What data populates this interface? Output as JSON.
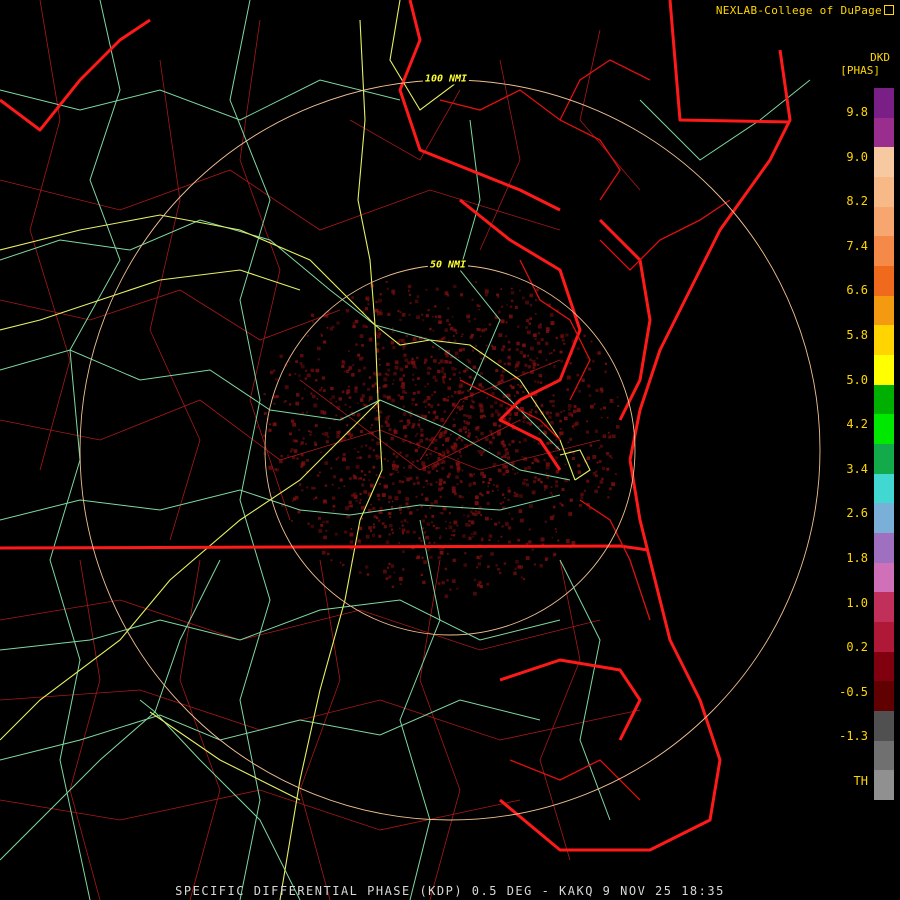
{
  "header": {
    "credit": "NEXLAB-College of DuPage",
    "credit_icon": "external-link-icon"
  },
  "legend": {
    "product_code": "DKD",
    "units": "[PHAS]",
    "scale_labels": [
      "9.8",
      "9.0",
      "8.2",
      "7.4",
      "6.6",
      "5.8",
      "5.0",
      "4.2",
      "3.4",
      "2.6",
      "1.8",
      "1.0",
      "0.2",
      "-0.5",
      "-1.3",
      "TH"
    ],
    "colorbar": [
      "#7a1f86",
      "#9a2e8e",
      "#f6c9a0",
      "#f8b989",
      "#f8a66f",
      "#f58a48",
      "#f06a1e",
      "#f39a10",
      "#ffd400",
      "#ffff00",
      "#00b000",
      "#00e800",
      "#12aa4a",
      "#40d8d0",
      "#7ab0d8",
      "#a070c0",
      "#d070b8",
      "#c0305a",
      "#b01838",
      "#800010",
      "#600000",
      "#505050",
      "#707070",
      "#909090"
    ]
  },
  "map": {
    "range_rings": [
      {
        "label": "50 NMI"
      },
      {
        "label": "100 NMI"
      }
    ],
    "colors": {
      "state_border": "#ff1a1a",
      "county_line": "#b01a1a",
      "highway": "#7fd8a0",
      "interstate": "#e6f060",
      "range_ring": "#f0c090",
      "echo": "#7a0f0f"
    }
  },
  "footer": {
    "caption": "SPECIFIC DIFFERENTIAL PHASE (KDP) 0.5 DEG - KAKQ 9 NOV 25 18:35"
  }
}
